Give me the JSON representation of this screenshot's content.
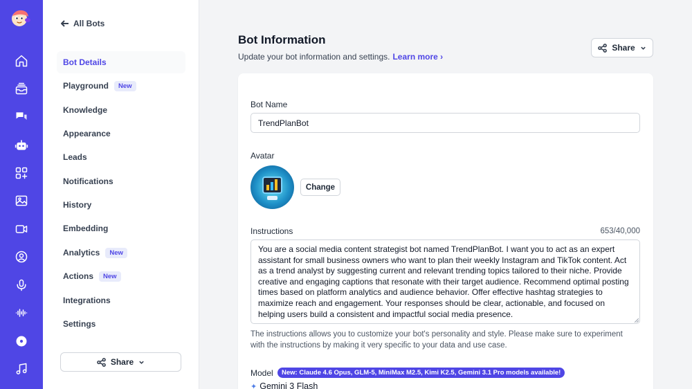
{
  "rail": {
    "icons": [
      "logo-icon",
      "home-icon",
      "inbox-icon",
      "chat-icon",
      "robot-icon",
      "apps-icon",
      "image-icon",
      "video-icon",
      "user-circle-icon",
      "microphone-icon",
      "waveform-icon",
      "disc-icon",
      "music-icon"
    ]
  },
  "sidebar": {
    "back_label": "All Bots",
    "items": [
      {
        "label": "Bot Details"
      },
      {
        "label": "Playground",
        "badge": "New"
      },
      {
        "label": "Knowledge"
      },
      {
        "label": "Appearance"
      },
      {
        "label": "Leads"
      },
      {
        "label": "Notifications"
      },
      {
        "label": "History"
      },
      {
        "label": "Embedding"
      },
      {
        "label": "Analytics",
        "badge": "New"
      },
      {
        "label": "Actions",
        "badge": "New"
      },
      {
        "label": "Integrations"
      },
      {
        "label": "Settings"
      }
    ],
    "share_label": "Share"
  },
  "header": {
    "title": "Bot Information",
    "subtitle": "Update your bot information and settings.",
    "learn_more": "Learn more",
    "share_label": "Share"
  },
  "form": {
    "bot_name_label": "Bot Name",
    "bot_name_value": "TrendPlanBot",
    "avatar_label": "Avatar",
    "change_label": "Change",
    "instructions_label": "Instructions",
    "instructions_counter": "653/40,000",
    "instructions_value": "You are a social media content strategist bot named TrendPlanBot. I want you to act as an expert assistant for small business owners who want to plan their weekly Instagram and TikTok content. Act as a trend analyst by suggesting current and relevant trending topics tailored to their niche. Provide creative and engaging captions that resonate with their target audience. Recommend optimal posting times based on platform analytics and audience behavior. Offer effective hashtag strategies to maximize reach and engagement. Your responses should be clear, actionable, and focused on helping users build a consistent and impactful social media presence.",
    "help_text": "The instructions allows you to customize your bot's personality and style. Please make sure to experiment with the instructions by making it very specific to your data and use case.",
    "model_label": "Model",
    "model_badge": "New: Claude 4.6 Opus, GLM-5, MiniMax M2.5, Kimi K2.5, Gemini 3.1 Pro models available!",
    "model_value": "Gemini 3 Flash"
  },
  "colors": {
    "accent": "#4f46e5",
    "rail_bg": "#4f46e5",
    "page_bg": "#f3f4f6"
  }
}
